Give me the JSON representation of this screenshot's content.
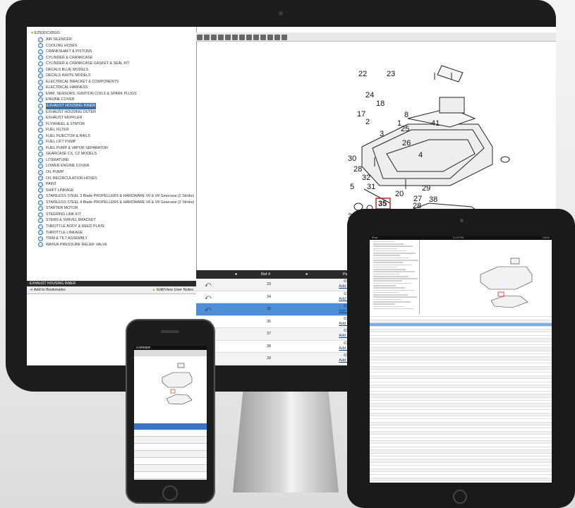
{
  "tree": {
    "root": "E25DDCXBGG",
    "items": [
      "AIR SILENCER",
      "COOLING HOSES",
      "CRANKSHAFT & PISTONS",
      "CYLINDER & CRANKCASE",
      "CYLINDER & CRANKCASE GASKET & SEAL KIT",
      "DECALS BLUE MODELS",
      "DECALS WHITE MODELS",
      "ELECTRICAL BRACKET & COMPONENTS",
      "ELECTRICAL HARNESS",
      "EMM, SENSORS, IGNITION COILS & SPARK PLUGS",
      "ENGINE COVER",
      "EXHAUST HOUSING INNER",
      "EXHAUST HOUSING OUTER",
      "EXHAUST MUFFLER",
      "FLYWHEEL & STATOR",
      "FUEL FILTER",
      "FUEL INJECTOR & RAILS",
      "FUEL LIFT PUMP",
      "FUEL PUMP & VAPOR SEPARATOR",
      "GEARCASE CX, CZ MODELS",
      "LITERATURE",
      "LOWER ENGINE COVER",
      "OIL PUMP",
      "OIL RECIRCULATION HOSES",
      "PAINT",
      "SHIFT LINKAGE",
      "STAINLESS STEEL 3 Blade PROPELLERS & HARDWARE V6 & V8 Gearcase (2 Stroke)",
      "STAINLESS STEEL 4 Blade PROPELLERS & HARDWARE V6 & V8 Gearcase (2 Stroke)",
      "STARTER MOTOR",
      "STEERING LINK KIT",
      "STERN & SWIVEL BRACKET",
      "THROTTLE BODY & REED PLATE",
      "THROTTLE LINKAGE",
      "TRIM & TILT ASSEMBLY",
      "WATER PRESSURE RELIEF VALVE"
    ],
    "selected_index": 11
  },
  "panel": {
    "title": "EXHAUST HOUSING INNER",
    "bookmark": "Add to Bookmarks",
    "notes": "Edit/View User Notes"
  },
  "grid": {
    "headers": [
      "Ref #",
      "Part #"
    ],
    "rows": [
      {
        "ref": "33",
        "part": "6124341",
        "pick": "Add to pick list"
      },
      {
        "ref": "34",
        "part": "6302290",
        "pick": "Add to pick list"
      },
      {
        "ref": "35",
        "part": "6326740",
        "pick": "Add to pick list"
      },
      {
        "ref": "36",
        "part": "6349557",
        "pick": "Add to pick list"
      },
      {
        "ref": "37",
        "part": "6349656",
        "pick": "Add to pick list"
      },
      {
        "ref": "38",
        "part": "6306503",
        "pick": "Add to pick list"
      },
      {
        "ref": "39",
        "part": "6326636",
        "pick": "Add to pick list"
      },
      {
        "ref": "41",
        "part": "6345752",
        "pick": "Add to pick list"
      }
    ],
    "highlight_row": 2
  },
  "diagram": {
    "callouts": [
      "22",
      "23",
      "24",
      "17",
      "18",
      "8",
      "2",
      "1",
      "25",
      "41",
      "3",
      "26",
      "4",
      "30",
      "28",
      "32",
      "5",
      "31",
      "20",
      "29",
      "27",
      "38",
      "28",
      "35",
      "36",
      "37",
      "11",
      "9"
    ],
    "highlighted": "35"
  },
  "tablet": {
    "left_status": "iPad",
    "time": "3:13 PM",
    "right_status": "100%"
  },
  "phone": {
    "carrier": "CARRIER"
  },
  "colors": {
    "select_blue": "#4d8fd6",
    "header_dark": "#2b2b2b",
    "link_blue": "#1a3e8c",
    "callout_red": "#d00000"
  }
}
